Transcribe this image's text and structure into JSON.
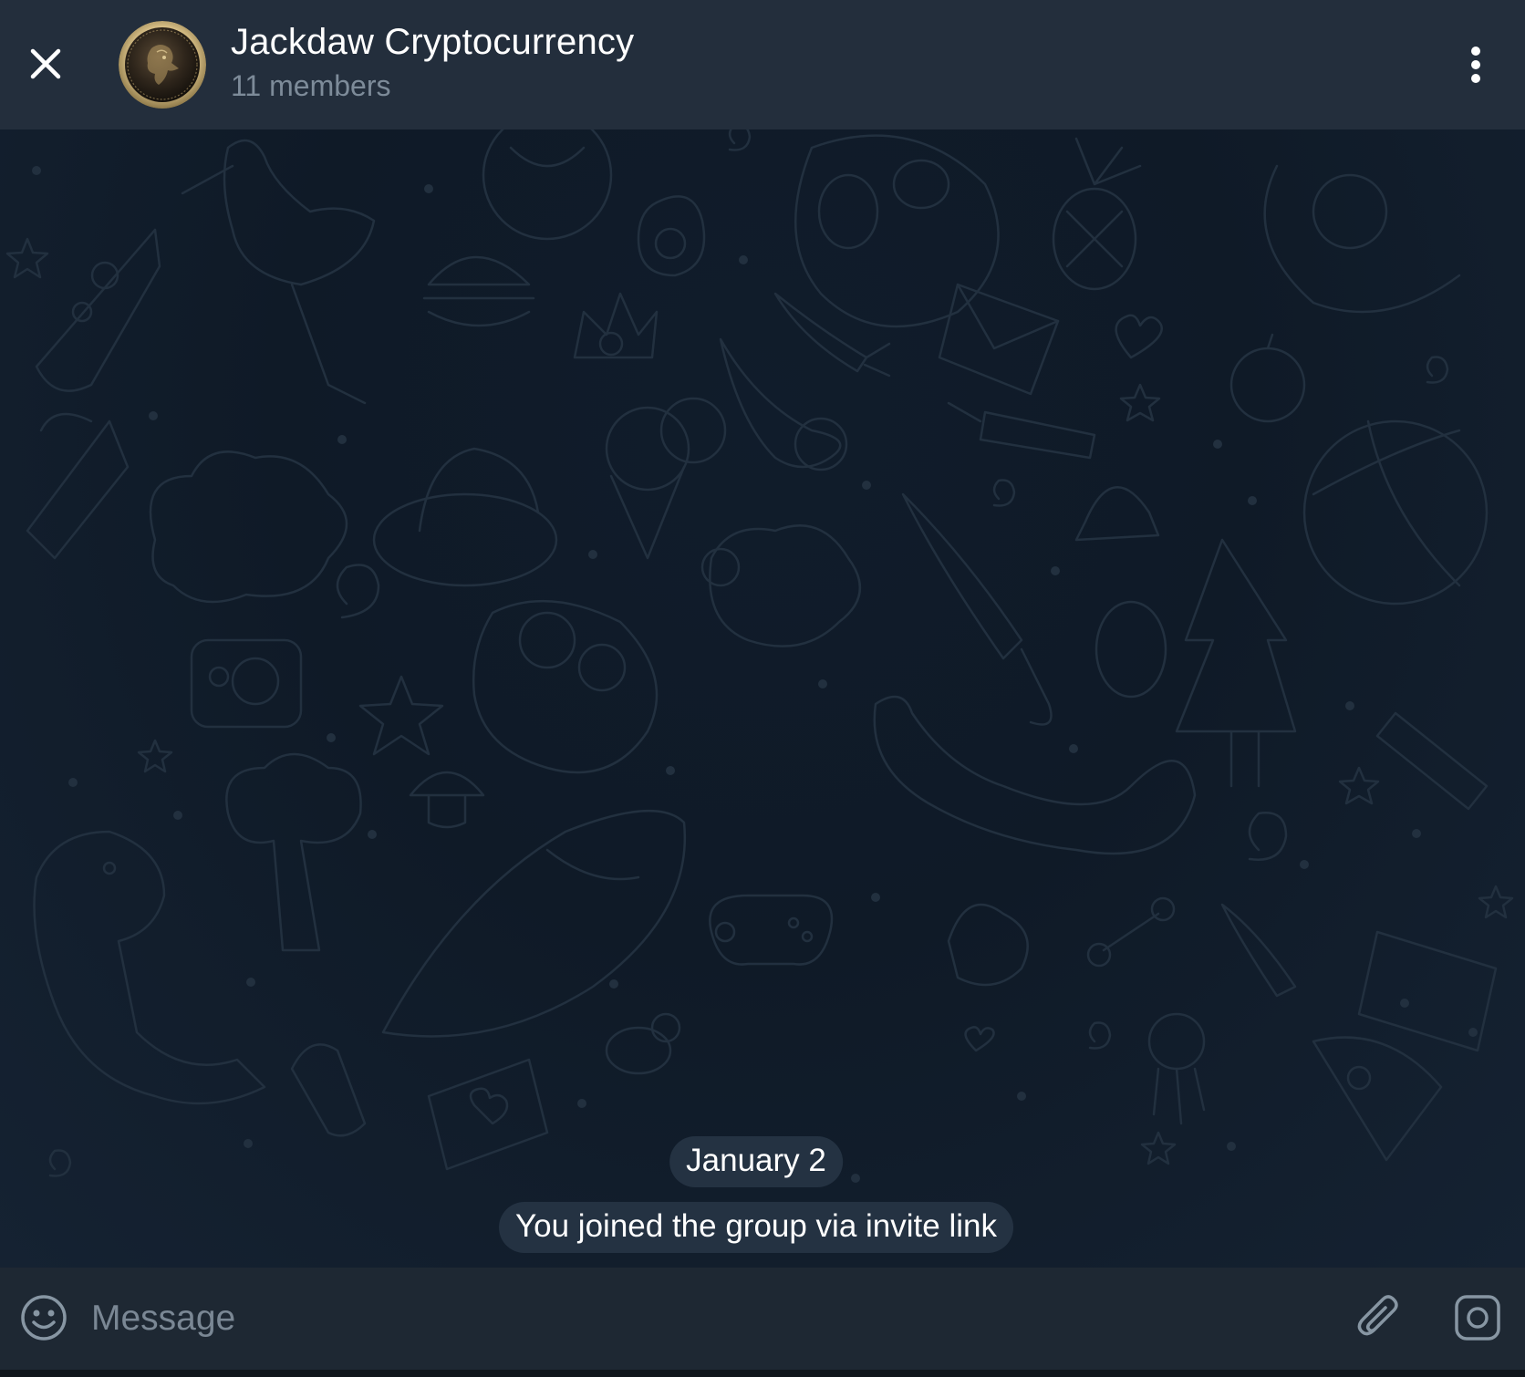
{
  "header": {
    "title": "Jackdaw Cryptocurrency",
    "subtitle": "11 members",
    "icons": {
      "close": "close-icon",
      "avatar": "group-avatar-coin",
      "menu": "more-vertical-icon"
    }
  },
  "chat": {
    "date_label": "January 2",
    "service_message": "You joined the group via invite link",
    "background_pattern": "doodle-pattern"
  },
  "composer": {
    "placeholder": "Message",
    "value": "",
    "icons": {
      "emoji": "smiley-icon",
      "attach": "paperclip-icon",
      "camera": "camera-icon"
    }
  },
  "colors": {
    "header_bg": "#232e3c",
    "chat_bg": "#0f1a27",
    "composer_bg": "#1e2833",
    "pill_bg": "#263444",
    "subtitle": "#7d8b99",
    "icon": "#8796a3",
    "pattern_stroke": "#243345"
  }
}
